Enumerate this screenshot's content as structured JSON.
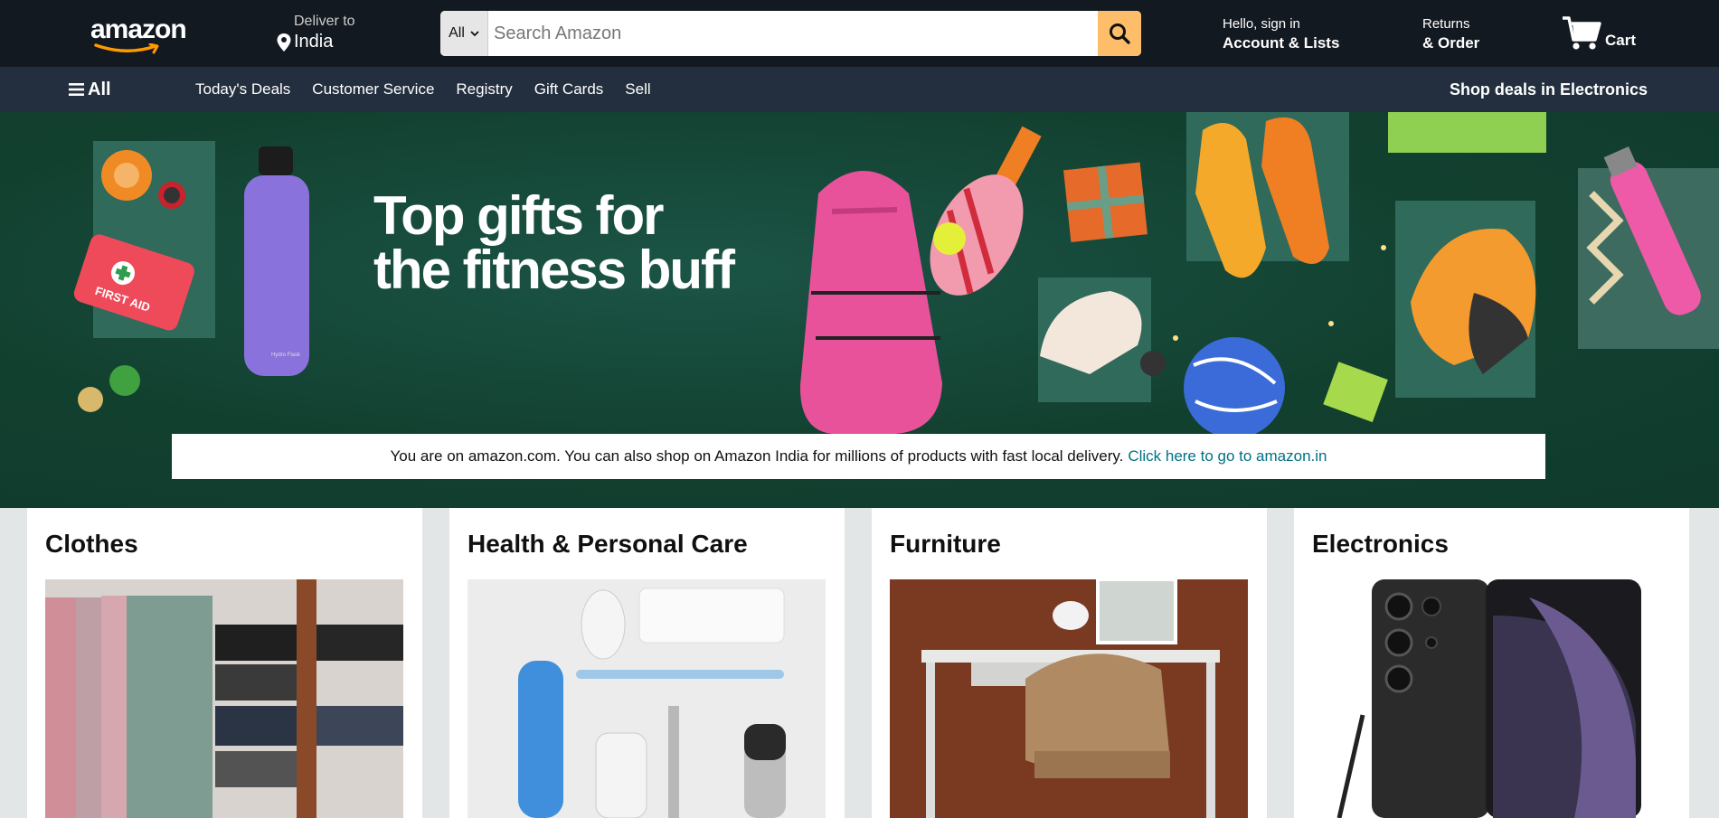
{
  "header": {
    "logo_text": "amazon",
    "deliver_line1": "Deliver to",
    "deliver_line2": "India",
    "search": {
      "department": "All",
      "placeholder": "Search Amazon"
    },
    "account_line1": "Hello, sign in",
    "account_line2": "Account & Lists",
    "returns_line1": "Returns",
    "returns_line2": "& Order",
    "cart_label": "Cart"
  },
  "subnav": {
    "all_label": "All",
    "links": [
      "Today's Deals",
      "Customer Service",
      "Registry",
      "Gift Cards",
      "Sell"
    ],
    "promo": "Shop deals in Electronics"
  },
  "hero": {
    "title_line1": "Top gifts for",
    "title_line2": "the fitness buff",
    "notice_text": "You are on amazon.com. You can also shop on Amazon India for millions of products with fast local delivery.",
    "notice_link": "Click here to go to amazon.in",
    "first_aid_text": "FIRST AID"
  },
  "cards": [
    {
      "title": "Clothes"
    },
    {
      "title": "Health & Personal Care"
    },
    {
      "title": "Furniture"
    },
    {
      "title": "Electronics"
    }
  ],
  "colors": {
    "topbar": "#131921",
    "subnav": "#232f3e",
    "search_button": "#febd69",
    "hero_bg": "#144237",
    "link": "#007185"
  }
}
